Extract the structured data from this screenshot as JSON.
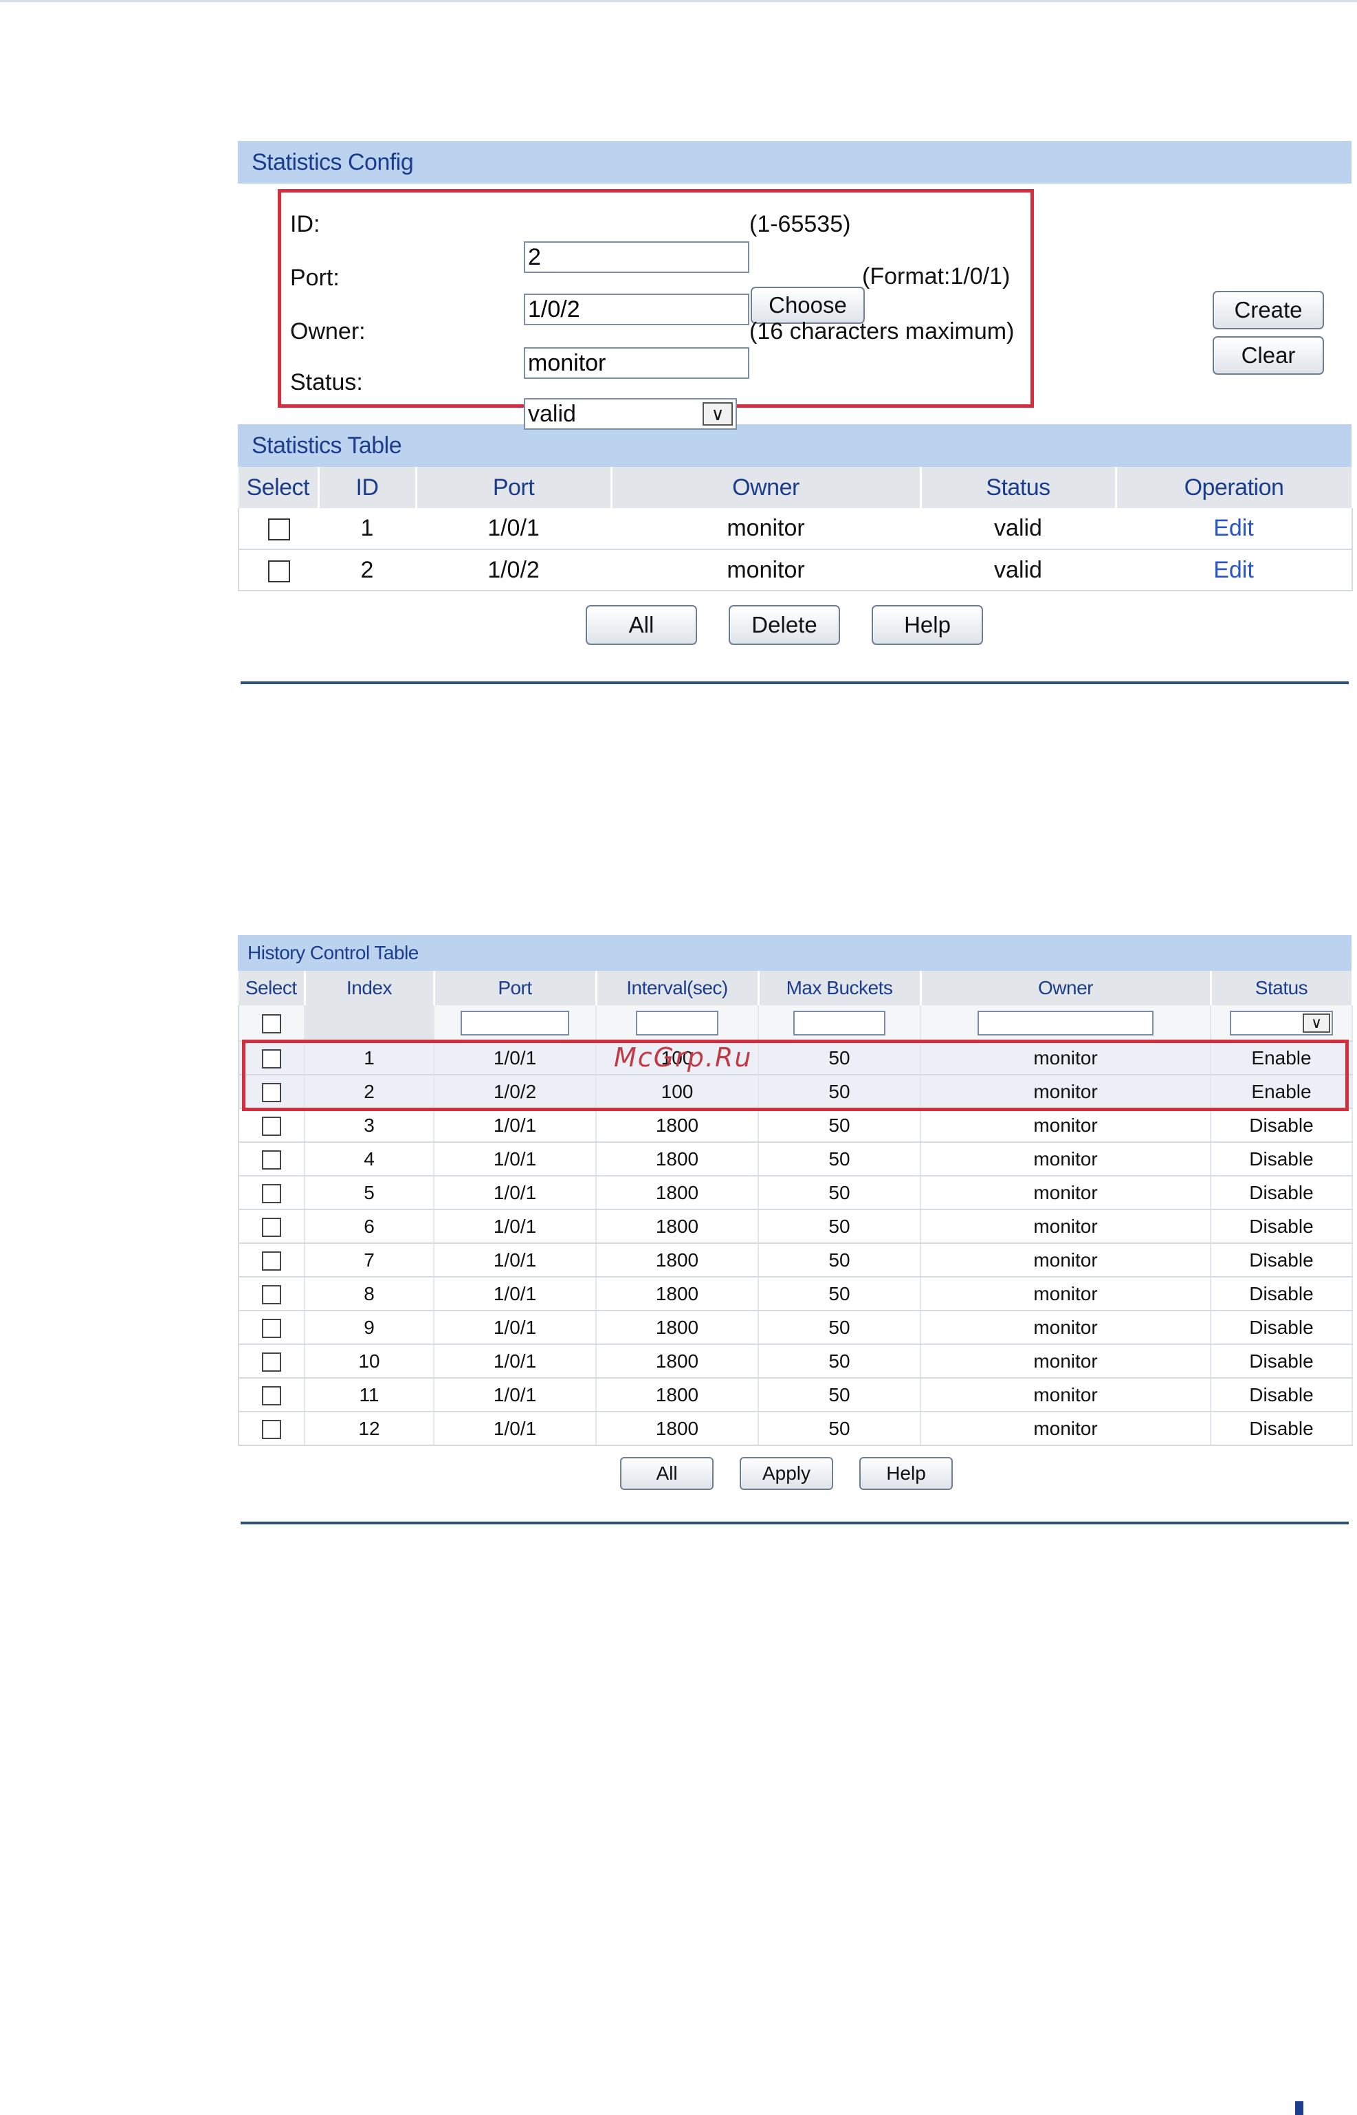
{
  "statistics_config": {
    "title": "Statistics Config",
    "fields": {
      "id": {
        "label": "ID:",
        "value": "2",
        "hint": "(1-65535)"
      },
      "port": {
        "label": "Port:",
        "value": "1/0/2",
        "choose_label": "Choose",
        "hint": "(Format:1/0/1)"
      },
      "owner": {
        "label": "Owner:",
        "value": "monitor",
        "hint": "(16 characters maximum)"
      },
      "status": {
        "label": "Status:",
        "value": "valid"
      }
    },
    "create_label": "Create",
    "clear_label": "Clear"
  },
  "statistics_table": {
    "title": "Statistics Table",
    "columns": [
      "Select",
      "ID",
      "Port",
      "Owner",
      "Status",
      "Operation"
    ],
    "rows": [
      {
        "id": "1",
        "port": "1/0/1",
        "owner": "monitor",
        "status": "valid",
        "operation": "Edit"
      },
      {
        "id": "2",
        "port": "1/0/2",
        "owner": "monitor",
        "status": "valid",
        "operation": "Edit"
      }
    ],
    "buttons": {
      "all": "All",
      "delete": "Delete",
      "help": "Help"
    }
  },
  "history_control_table": {
    "title": "History Control Table",
    "columns": [
      "Select",
      "Index",
      "Port",
      "Interval(sec)",
      "Max Buckets",
      "Owner",
      "Status"
    ],
    "rows": [
      {
        "index": "1",
        "port": "1/0/1",
        "interval": "100",
        "max_buckets": "50",
        "owner": "monitor",
        "status": "Enable"
      },
      {
        "index": "2",
        "port": "1/0/2",
        "interval": "100",
        "max_buckets": "50",
        "owner": "monitor",
        "status": "Enable"
      },
      {
        "index": "3",
        "port": "1/0/1",
        "interval": "1800",
        "max_buckets": "50",
        "owner": "monitor",
        "status": "Disable"
      },
      {
        "index": "4",
        "port": "1/0/1",
        "interval": "1800",
        "max_buckets": "50",
        "owner": "monitor",
        "status": "Disable"
      },
      {
        "index": "5",
        "port": "1/0/1",
        "interval": "1800",
        "max_buckets": "50",
        "owner": "monitor",
        "status": "Disable"
      },
      {
        "index": "6",
        "port": "1/0/1",
        "interval": "1800",
        "max_buckets": "50",
        "owner": "monitor",
        "status": "Disable"
      },
      {
        "index": "7",
        "port": "1/0/1",
        "interval": "1800",
        "max_buckets": "50",
        "owner": "monitor",
        "status": "Disable"
      },
      {
        "index": "8",
        "port": "1/0/1",
        "interval": "1800",
        "max_buckets": "50",
        "owner": "monitor",
        "status": "Disable"
      },
      {
        "index": "9",
        "port": "1/0/1",
        "interval": "1800",
        "max_buckets": "50",
        "owner": "monitor",
        "status": "Disable"
      },
      {
        "index": "10",
        "port": "1/0/1",
        "interval": "1800",
        "max_buckets": "50",
        "owner": "monitor",
        "status": "Disable"
      },
      {
        "index": "11",
        "port": "1/0/1",
        "interval": "1800",
        "max_buckets": "50",
        "owner": "monitor",
        "status": "Disable"
      },
      {
        "index": "12",
        "port": "1/0/1",
        "interval": "1800",
        "max_buckets": "50",
        "owner": "monitor",
        "status": "Disable"
      }
    ],
    "buttons": {
      "all": "All",
      "apply": "Apply",
      "help": "Help"
    }
  },
  "watermark": "McGrp.Ru",
  "colors": {
    "accent_bar": "#bcd3f0",
    "header_text": "#1b3d8c",
    "highlight_box": "#d32f3f",
    "link": "#2a55c8"
  }
}
